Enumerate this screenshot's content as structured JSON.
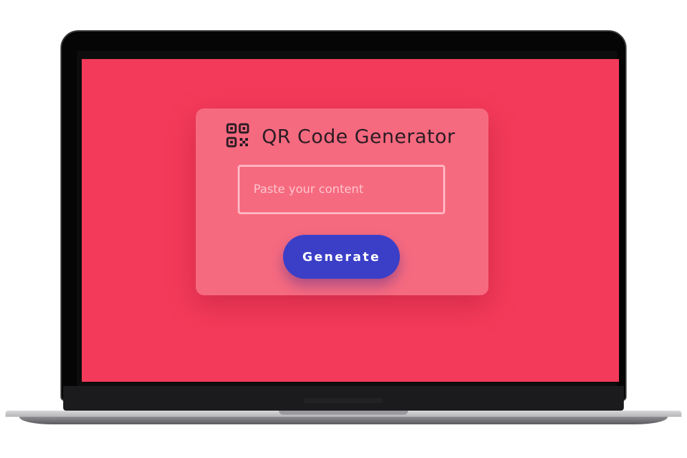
{
  "app": {
    "title": "QR Code Generator",
    "icon": "qr-code-icon"
  },
  "form": {
    "input_value": "",
    "input_placeholder": "Paste your content",
    "generate_label": "Generate"
  },
  "colors": {
    "screen_background": "#f43a5a",
    "card_background": "#f66a7f",
    "button_background": "#3b3fc7",
    "input_border": "#ffb6c1",
    "title_text": "#2b1c24"
  }
}
